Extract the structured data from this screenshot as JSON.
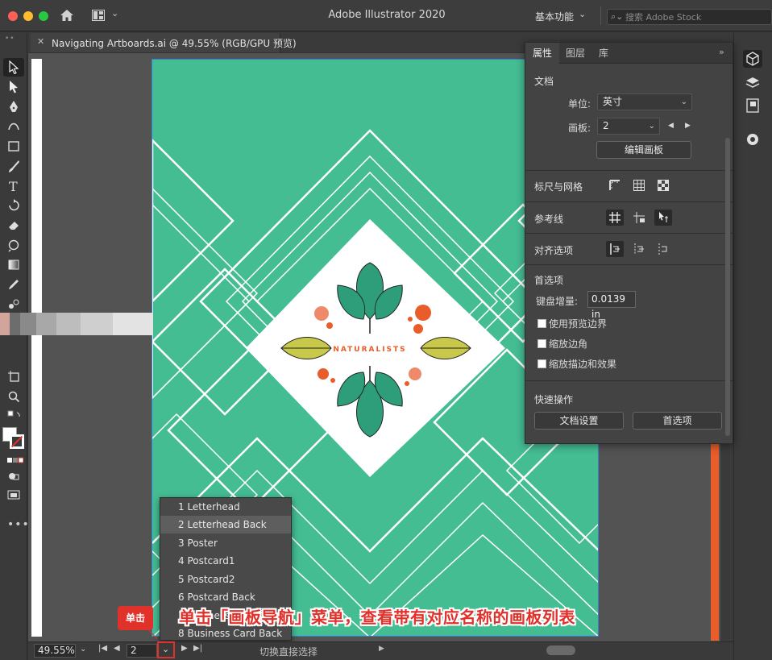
{
  "app": {
    "title": "Adobe Illustrator 2020",
    "workspace": "基本功能",
    "stock_search_placeholder": "搜索 Adobe Stock"
  },
  "document": {
    "tab_title": "Navigating Artboards.ai @ 49.55% (RGB/GPU 预览)"
  },
  "artwork": {
    "brand_text": "NATURALISTS",
    "colors": {
      "background": "#44bd93",
      "accent_orange": "#e85d2a",
      "leaf_green": "#2e9e7a",
      "leaf_lime": "#c8c94a",
      "line_white": "#ffffff"
    }
  },
  "artboard_menu": {
    "items": [
      "1 Letterhead",
      "2 Letterhead Back",
      "3 Poster",
      "4 Postcard1",
      "5 Postcard2",
      "6 Postcard Back",
      "7 Business Card",
      "8 Business Card Back"
    ],
    "highlighted_index": 1
  },
  "status_bar": {
    "zoom": "49.55%",
    "artboard_number": "2",
    "tool_status": "切换直接选择"
  },
  "callout": {
    "badge": "单击",
    "text": "单击「画板导航」菜单，查看带有对应名称的画板列表",
    "color": "#e0312b"
  },
  "panel": {
    "tabs": [
      "属性",
      "图层",
      "库"
    ],
    "active_tab": "属性",
    "document_section": {
      "title": "文档",
      "units_label": "单位:",
      "units_value": "英寸",
      "artboard_label": "画板:",
      "artboard_value": "2",
      "edit_artboards_button": "编辑画板"
    },
    "rulers_grids_title": "标尺与网格",
    "guides_title": "参考线",
    "align_options_title": "对齐选项",
    "preferences": {
      "title": "首选项",
      "keyboard_increment_label": "键盘增量:",
      "keyboard_increment_value": "0.0139 in",
      "checkboxes": [
        "使用预览边界",
        "缩放边角",
        "缩放描边和效果"
      ]
    },
    "quick_actions": {
      "title": "快速操作",
      "document_setup_button": "文档设置",
      "preferences_button": "首选项"
    }
  }
}
